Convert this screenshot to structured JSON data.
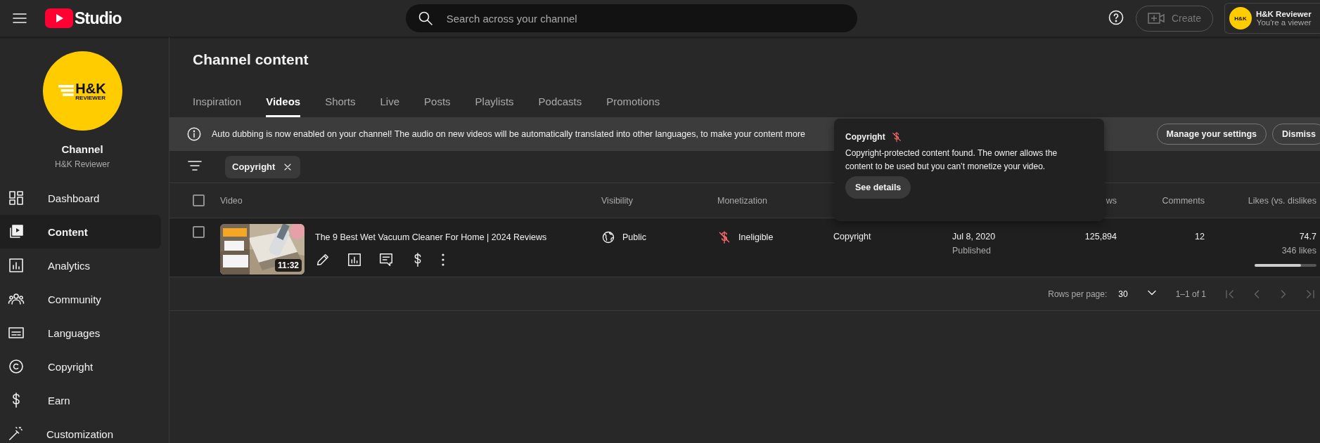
{
  "topbar": {
    "logo_text": "Studio",
    "search": {
      "placeholder": "Search across your channel"
    },
    "create_button": {
      "label": "Create",
      "disabled": true
    },
    "account": {
      "name": "H&K Reviewer",
      "role": "You're a viewer",
      "avatar_text": "H&K"
    }
  },
  "sidebar": {
    "channel": {
      "logo_text": "H&K",
      "logo_subtext": "REVIEWER",
      "title": "Channel",
      "name": "H&K Reviewer"
    },
    "items": [
      {
        "label": "Dashboard",
        "selected": false
      },
      {
        "label": "Content",
        "selected": true
      },
      {
        "label": "Analytics",
        "selected": false
      },
      {
        "label": "Community",
        "selected": false
      },
      {
        "label": "Languages",
        "selected": false
      },
      {
        "label": "Copyright",
        "selected": false
      },
      {
        "label": "Earn",
        "selected": false
      },
      {
        "label": "Customization",
        "selected": false
      }
    ]
  },
  "page": {
    "title": "Channel content",
    "tabs": [
      {
        "label": "Inspiration",
        "selected": false
      },
      {
        "label": "Videos",
        "selected": true
      },
      {
        "label": "Shorts",
        "selected": false
      },
      {
        "label": "Live",
        "selected": false
      },
      {
        "label": "Posts",
        "selected": false
      },
      {
        "label": "Playlists",
        "selected": false
      },
      {
        "label": "Podcasts",
        "selected": false
      },
      {
        "label": "Promotions",
        "selected": false
      }
    ]
  },
  "banner": {
    "text": "Auto dubbing is now enabled on your channel! The audio on new videos will be automatically translated into other languages, to make your content more",
    "buttons": [
      "Manage your settings",
      "Dismiss"
    ]
  },
  "filters": [
    {
      "label": "Copyright"
    }
  ],
  "table": {
    "select_all": {
      "selected": false
    },
    "headers": {
      "video": "Video",
      "visibility": "Visibility",
      "monetization": "Monetization",
      "views": "ws",
      "comments": "Comments",
      "likes": "Likes (vs. dislikes"
    },
    "rows": [
      {
        "selected": false,
        "title": "The 9 Best Wet Vacuum Cleaner For Home | 2024 Reviews",
        "duration": "11:32",
        "visibility": "Public",
        "monetization": "Ineligible",
        "restrictions": "Copyright",
        "date": "Jul 8, 2020",
        "date_status": "Published",
        "views": "125,894",
        "comments": "12",
        "likes_percent": "74.7",
        "likes_count": "346 likes",
        "level": 0.747
      }
    ]
  },
  "pagination": {
    "rows_per_page_label": "Rows per page:",
    "rows_per_page": "30",
    "range": "1–1 of 1"
  },
  "popup": {
    "title": "Copyright",
    "text": "Copyright-protected content found. The owner allows the content to be used but you can’t monetize your video.",
    "button": "See details"
  }
}
